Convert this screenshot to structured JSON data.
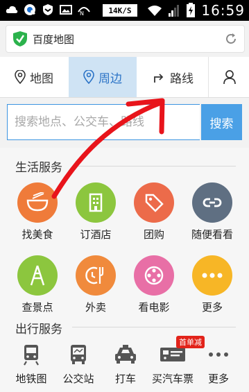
{
  "status_bar": {
    "speed": "14K/S",
    "time": "16:59",
    "icons": [
      "cloud-icon",
      "q-icon",
      "shield-icon",
      "picture-icon",
      "signal-icon",
      "wifi-icon",
      "cellular-icon",
      "battery-icon"
    ]
  },
  "address_bar": {
    "title": "百度地图",
    "icons": [
      "green-shield-icon",
      "refresh-icon"
    ]
  },
  "tabs": [
    {
      "label": "地图",
      "icon": "location-pin-icon",
      "active": false
    },
    {
      "label": "周边",
      "icon": "nearby-pin-icon",
      "active": true
    },
    {
      "label": "路线",
      "icon": "route-icon",
      "active": false
    },
    {
      "label": "",
      "icon": "user-icon",
      "active": false
    }
  ],
  "search": {
    "placeholder": "搜索地点、公交车、路线",
    "button": "搜索"
  },
  "life_services": {
    "title": "生活服务",
    "items": [
      {
        "label": "找美食",
        "icon": "food-bowl-icon",
        "color": "#ef7b3a"
      },
      {
        "label": "订酒店",
        "icon": "hotel-icon",
        "color": "#8cc63e"
      },
      {
        "label": "团购",
        "icon": "tag-icon",
        "color": "#ec6b4a"
      },
      {
        "label": "随便看看",
        "icon": "link-icon",
        "color": "#5f6f82"
      },
      {
        "label": "查景点",
        "icon": "tower-icon",
        "color": "#8cc63e"
      },
      {
        "label": "外卖",
        "icon": "takeout-icon",
        "color": "#f08a3c"
      },
      {
        "label": "看电影",
        "icon": "film-reel-icon",
        "color": "#e86fa6"
      },
      {
        "label": "更多",
        "icon": "more-dots-icon",
        "color": "#f7b626"
      }
    ]
  },
  "travel_services": {
    "title": "出行服务",
    "badge": "首单减",
    "items": [
      {
        "label": "地铁图",
        "icon": "subway-icon"
      },
      {
        "label": "公交站",
        "icon": "bus-icon"
      },
      {
        "label": "打车",
        "icon": "taxi-icon"
      },
      {
        "label": "买汽车票",
        "icon": "bus-ticket-icon"
      },
      {
        "label": "更多",
        "icon": "more-dots-icon"
      }
    ]
  },
  "colors": {
    "accent_blue": "#4aa0e6",
    "active_tab_bg": "#cfe3f4",
    "annotation_red": "#e8141b"
  }
}
